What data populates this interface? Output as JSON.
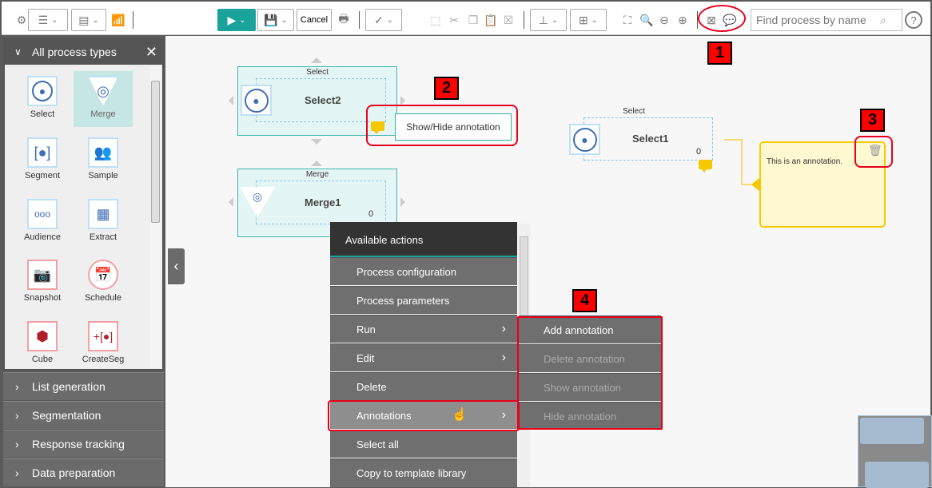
{
  "toolbar": {
    "cancel_label": "Cancel",
    "search_placeholder": "Find process by name",
    "accent": "#1aa39a"
  },
  "palette": {
    "title": "All process types",
    "items": [
      {
        "label": "Select",
        "icon": "select-icon"
      },
      {
        "label": "Merge",
        "icon": "merge-icon"
      },
      {
        "label": "Segment",
        "icon": "segment-icon"
      },
      {
        "label": "Sample",
        "icon": "sample-icon"
      },
      {
        "label": "Audience",
        "icon": "audience-icon"
      },
      {
        "label": "Extract",
        "icon": "extract-icon"
      },
      {
        "label": "Snapshot",
        "icon": "snapshot-icon"
      },
      {
        "label": "Schedule",
        "icon": "schedule-icon"
      },
      {
        "label": "Cube",
        "icon": "cube-icon"
      },
      {
        "label": "CreateSeg",
        "icon": "createseg-icon"
      }
    ]
  },
  "accordion": [
    "List generation",
    "Segmentation",
    "Response tracking",
    "Data preparation"
  ],
  "nodes": {
    "select2": {
      "type": "Select",
      "title": "Select2"
    },
    "merge1": {
      "type": "Merge",
      "title": "Merge1",
      "count": "0"
    },
    "select1": {
      "type": "Select",
      "title": "Select1",
      "count": "0"
    }
  },
  "tooltip": "Show/Hide annotation",
  "annotation": {
    "text": "This is an annotation.",
    "border": "#f5cc00",
    "fill": "#fff8d0"
  },
  "context_menu": {
    "title": "Available actions",
    "items": [
      "Process configuration",
      "Process parameters",
      "Run",
      "Edit",
      "Delete",
      "Annotations",
      "Select all",
      "Copy to template library"
    ]
  },
  "submenu": {
    "items": [
      "Add annotation",
      "Delete annotation",
      "Show annotation",
      "Hide annotation"
    ]
  },
  "callouts": [
    "1",
    "2",
    "3",
    "4"
  ]
}
